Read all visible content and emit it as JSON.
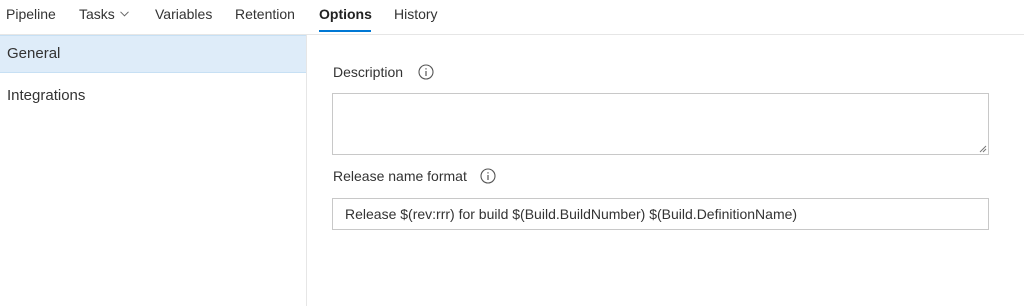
{
  "tabs": [
    {
      "label": "Pipeline"
    },
    {
      "label": "Tasks"
    },
    {
      "label": "Variables"
    },
    {
      "label": "Retention"
    },
    {
      "label": "Options",
      "active": true
    },
    {
      "label": "History"
    }
  ],
  "sidebar": {
    "items": [
      {
        "label": "General",
        "selected": true
      },
      {
        "label": "Integrations"
      }
    ]
  },
  "form": {
    "description": {
      "label": "Description",
      "value": ""
    },
    "release_name_format": {
      "label": "Release name format",
      "value": "Release $(rev:rrr) for build $(Build.BuildNumber) $(Build.DefinitionName)"
    }
  },
  "colors": {
    "accent": "#0078d4",
    "selected_bg": "#deecf9"
  },
  "icons": {
    "info": "info-icon",
    "tasks_dropdown": "chevron-down-icon"
  }
}
